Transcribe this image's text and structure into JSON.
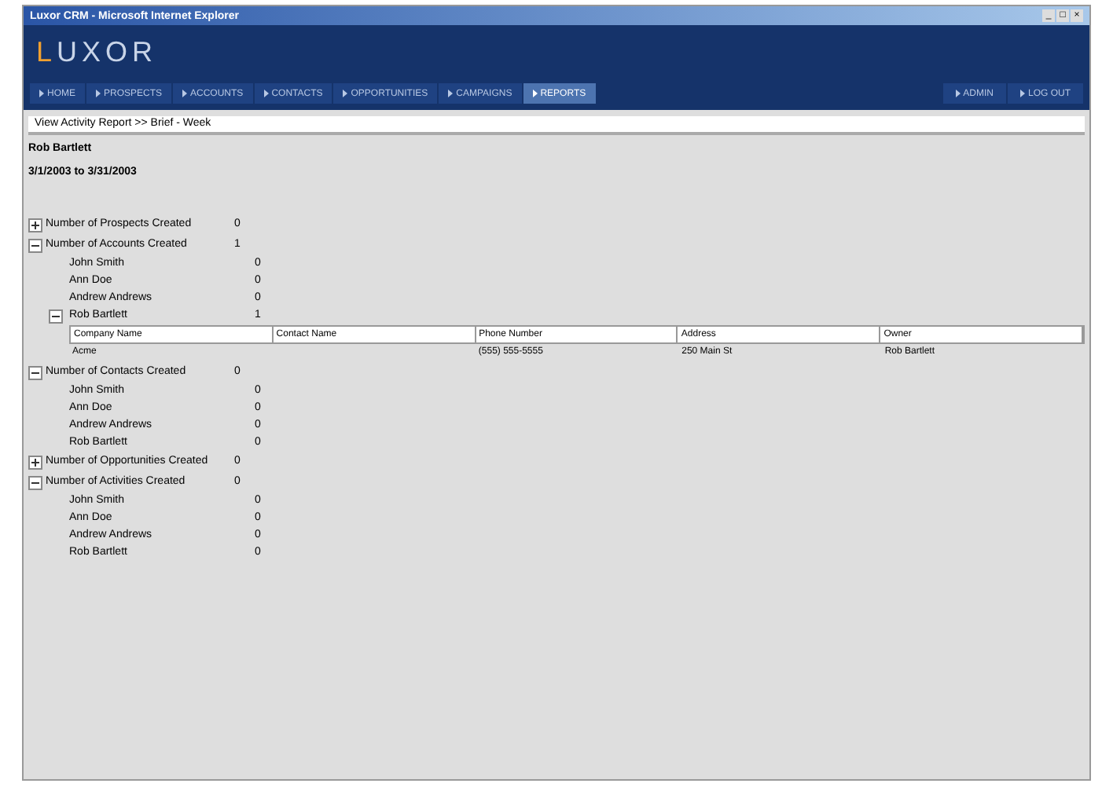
{
  "window": {
    "title": "Luxor CRM - Microsoft Internet Explorer",
    "controls": [
      "_",
      "□",
      "×"
    ]
  },
  "logo": {
    "first": "L",
    "rest": "UXOR"
  },
  "tabs": [
    {
      "label": "HOME",
      "selected": false
    },
    {
      "label": "PROSPECTS",
      "selected": false
    },
    {
      "label": "ACCOUNTS",
      "selected": false
    },
    {
      "label": "CONTACTS",
      "selected": false
    },
    {
      "label": "OPPORTUNITIES",
      "selected": false
    },
    {
      "label": "CAMPAIGNS",
      "selected": false
    },
    {
      "label": "REPORTS",
      "selected": true
    }
  ],
  "right_tabs": [
    {
      "label": "ADMIN"
    },
    {
      "label": "LOG OUT"
    }
  ],
  "breadcrumb": "View Activity Report >> Brief - Week",
  "user": "Rob Bartlett",
  "date_range": "3/1/2003 to 3/31/2003",
  "sections": [
    {
      "label": "Number of Prospects Created",
      "count": "0",
      "expanded": false
    },
    {
      "label": "Number of Accounts Created",
      "count": "1",
      "expanded": true,
      "users": [
        {
          "name": "John Smith",
          "count": "0"
        },
        {
          "name": "Ann Doe",
          "count": "0"
        },
        {
          "name": "Andrew Andrews",
          "count": "0"
        },
        {
          "name": "Rob Bartlett",
          "count": "1",
          "expanded": true,
          "table": {
            "columns": [
              "Company Name",
              "Contact Name",
              "Phone Number",
              "Address",
              "Owner"
            ],
            "rows": [
              [
                "Acme",
                "",
                "(555) 555-5555",
                "250 Main St",
                "Rob Bartlett"
              ]
            ]
          }
        }
      ]
    },
    {
      "label": "Number of Contacts Created",
      "count": "0",
      "expanded": true,
      "users": [
        {
          "name": "John Smith",
          "count": "0"
        },
        {
          "name": "Ann Doe",
          "count": "0"
        },
        {
          "name": "Andrew Andrews",
          "count": "0"
        },
        {
          "name": "Rob Bartlett",
          "count": "0"
        }
      ]
    },
    {
      "label": "Number of Opportunities Created",
      "count": "0",
      "expanded": false
    },
    {
      "label": "Number of Activities Created",
      "count": "0",
      "expanded": true,
      "users": [
        {
          "name": "John Smith",
          "count": "0"
        },
        {
          "name": "Ann Doe",
          "count": "0"
        },
        {
          "name": "Andrew Andrews",
          "count": "0"
        },
        {
          "name": "Rob Bartlett",
          "count": "0"
        }
      ]
    }
  ]
}
